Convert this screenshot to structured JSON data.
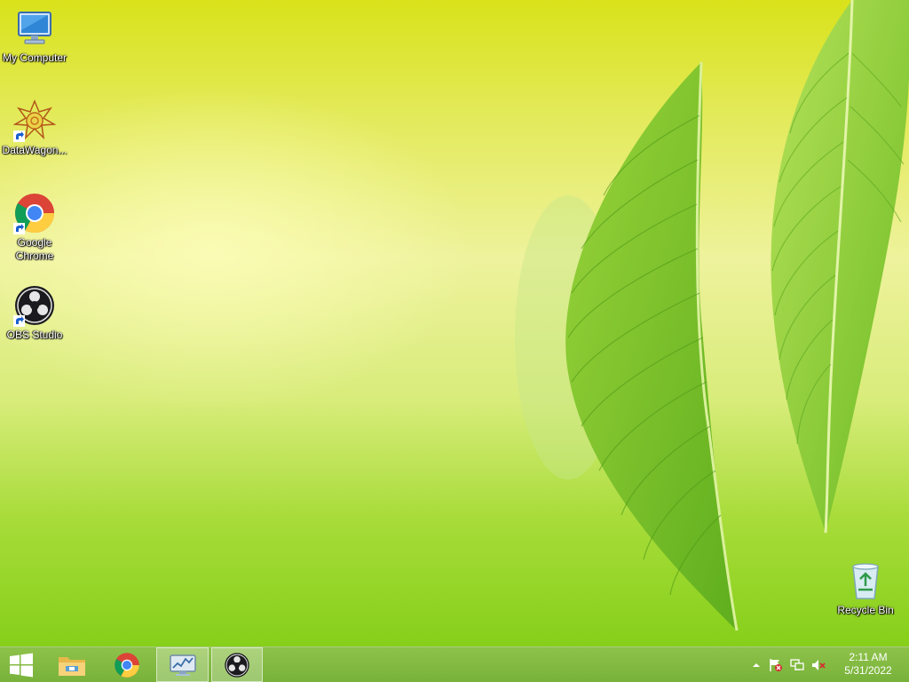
{
  "desktop": {
    "icons": [
      {
        "label": "My Computer",
        "icon": "computer-icon"
      },
      {
        "label": "DataWagon...",
        "icon": "datawagon-icon"
      },
      {
        "label": "Google Chrome",
        "icon": "chrome-icon"
      },
      {
        "label": "OBS Studio",
        "icon": "obs-icon"
      },
      {
        "label": "Recycle Bin",
        "icon": "recycle-bin-icon"
      }
    ]
  },
  "taskbar": {
    "start_icon": "windows-logo-icon",
    "pinned": [
      {
        "icon": "file-explorer-icon",
        "active": false
      },
      {
        "icon": "chrome-icon",
        "active": false
      },
      {
        "icon": "resource-monitor-icon",
        "active": true
      },
      {
        "icon": "obs-icon",
        "active": true
      }
    ],
    "tray": {
      "icons": [
        "show-hidden-icons-chevron",
        "action-center-flag-icon",
        "network-icon",
        "volume-muted-icon"
      ],
      "time": "2:11 AM",
      "date": "5/31/2022"
    }
  },
  "colors": {
    "taskbar": "#7fb840",
    "desktop_top": "#d9e21a",
    "desktop_bottom": "#86cf1a"
  }
}
